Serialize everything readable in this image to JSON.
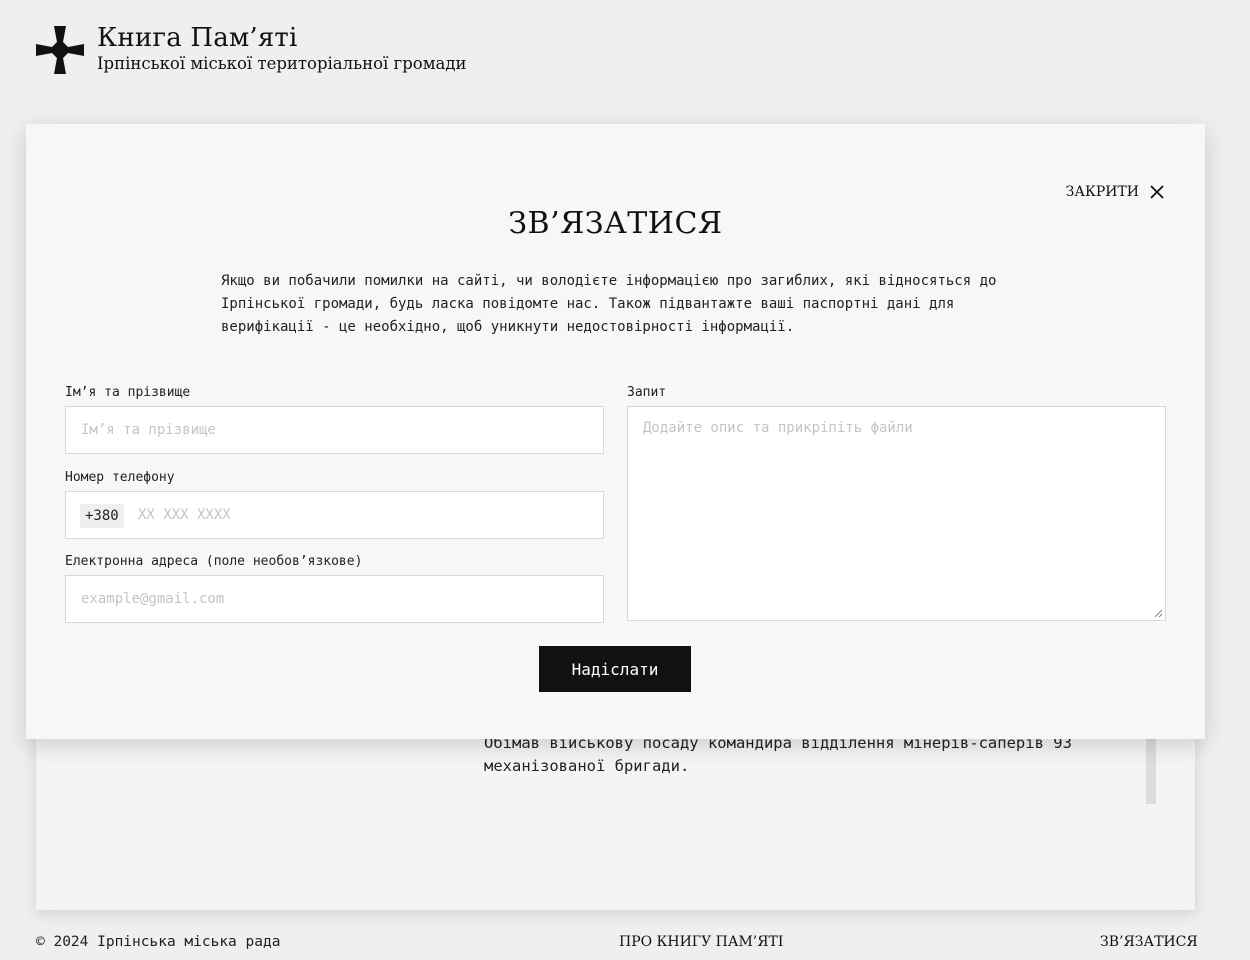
{
  "header": {
    "title": "Книга Пам’яті",
    "subtitle": "Ірпінської міської територіальної громади",
    "logo_icon": "cross-icon"
  },
  "background_card": {
    "text": "Обімав військову посаду командира відділення мінерів-саперів 93 механізованої бригади."
  },
  "modal": {
    "close_label": "ЗАКРИТИ",
    "title": "ЗВ’ЯЗАТИСЯ",
    "description": "Якщо ви побачили помилки на сайті, чи володієте інформацією про загиблих, які відносяться до Ірпінської громади, будь ласка повідомте нас. Також підвантажте ваші паспортні дані для верифікації - це необхідно, щоб уникнути недостовірності інформації.",
    "fields": {
      "name": {
        "label": "Ім’я та прізвище",
        "placeholder": "Ім’я та прізвище",
        "value": ""
      },
      "phone": {
        "label": "Номер телефону",
        "prefix": "+380",
        "placeholder": "XX XXX XXXX",
        "value": ""
      },
      "email": {
        "label": "Електронна адреса (поле необов’язкове)",
        "placeholder": "example@gmail.com",
        "value": ""
      },
      "request": {
        "label": "Запит",
        "placeholder": "Додайте опис та прикріпіть файли",
        "value": ""
      }
    },
    "submit_label": "Надіслати"
  },
  "footer": {
    "copyright": "© 2024 Ірпінська міська рада",
    "about_link": "ПРО КНИГУ ПАМ’ЯТІ",
    "contact_link": "ЗВ’ЯЗАТИСЯ"
  },
  "colors": {
    "page_bg": "#efefed",
    "modal_bg": "#f7f7f5",
    "button_bg": "#111111",
    "text": "#1a1a1a"
  }
}
